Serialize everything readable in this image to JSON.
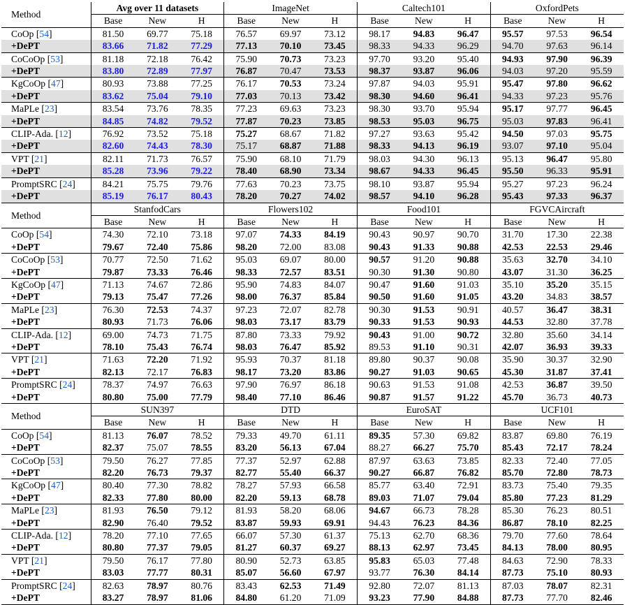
{
  "header_label": "Method",
  "col_labels": [
    "Base",
    "New",
    "H"
  ],
  "blocks": [
    {
      "datasets": [
        "Avg over 11 datasets",
        "ImageNet",
        "Caltech101",
        "OxfordPets"
      ],
      "first_bold": true,
      "shaded": true,
      "groups": [
        {
          "method": "CoOp",
          "cite": "54",
          "row1": [
            "81.50",
            "69.77",
            "75.18",
            "76.57",
            "69.97",
            "73.12",
            "98.17",
            "94.83",
            "96.47",
            "95.57",
            "97.53",
            "96.54"
          ],
          "row2": [
            "83.66",
            "71.82",
            "77.29",
            "77.13",
            "70.10",
            "73.45",
            "98.33",
            "94.33",
            "96.29",
            "94.70",
            "97.63",
            "96.14"
          ]
        },
        {
          "method": "CoCoOp",
          "cite": "53",
          "row1": [
            "81.18",
            "72.18",
            "76.42",
            "75.90",
            "70.73",
            "73.23",
            "97.70",
            "93.20",
            "95.40",
            "94.93",
            "97.90",
            "96.39"
          ],
          "row2": [
            "83.80",
            "72.89",
            "77.97",
            "76.87",
            "70.47",
            "73.53",
            "98.37",
            "93.87",
            "96.06",
            "94.03",
            "97.20",
            "95.59"
          ]
        },
        {
          "method": "KgCoOp",
          "cite": "47",
          "row1": [
            "80.93",
            "73.88",
            "77.25",
            "76.17",
            "70.53",
            "73.24",
            "97.87",
            "94.03",
            "95.91",
            "95.47",
            "97.80",
            "96.62"
          ],
          "row2": [
            "83.62",
            "75.04",
            "79.10",
            "77.03",
            "70.13",
            "73.42",
            "98.30",
            "94.60",
            "96.41",
            "94.33",
            "97.23",
            "95.76"
          ]
        },
        {
          "method": "MaPLe",
          "cite": "23",
          "row1": [
            "83.54",
            "73.76",
            "78.35",
            "77.23",
            "69.63",
            "73.23",
            "98.30",
            "93.70",
            "95.94",
            "95.17",
            "97.77",
            "96.45"
          ],
          "row2": [
            "84.85",
            "74.82",
            "79.52",
            "77.87",
            "70.23",
            "73.85",
            "98.53",
            "95.03",
            "96.75",
            "95.03",
            "97.83",
            "96.41"
          ]
        },
        {
          "method": "CLIP-Ada.",
          "cite": "12",
          "row1": [
            "76.92",
            "73.52",
            "75.18",
            "75.27",
            "68.67",
            "71.82",
            "97.27",
            "93.63",
            "95.42",
            "94.50",
            "97.03",
            "95.75"
          ],
          "row2": [
            "82.60",
            "74.43",
            "78.30",
            "75.17",
            "68.87",
            "71.88",
            "98.33",
            "94.13",
            "96.19",
            "93.07",
            "97.10",
            "95.04"
          ]
        },
        {
          "method": "VPT",
          "cite": "21",
          "row1": [
            "82.11",
            "71.73",
            "76.57",
            "75.90",
            "68.10",
            "71.79",
            "98.03",
            "94.30",
            "96.13",
            "95.13",
            "96.47",
            "95.80"
          ],
          "row2": [
            "85.28",
            "73.96",
            "79.22",
            "78.40",
            "68.90",
            "73.34",
            "98.67",
            "94.33",
            "96.45",
            "95.50",
            "96.33",
            "95.91"
          ]
        },
        {
          "method": "PromptSRC",
          "cite": "24",
          "row1": [
            "84.21",
            "75.75",
            "79.76",
            "77.63",
            "70.23",
            "73.75",
            "98.10",
            "93.87",
            "95.94",
            "95.27",
            "97.23",
            "96.24"
          ],
          "row2": [
            "85.19",
            "76.17",
            "80.43",
            "78.20",
            "70.27",
            "74.02",
            "98.57",
            "94.10",
            "96.28",
            "95.43",
            "97.33",
            "96.37"
          ]
        }
      ]
    },
    {
      "datasets": [
        "StanfodCars",
        "Flowers102",
        "Food101",
        "FGVCAircraft"
      ],
      "first_bold": false,
      "shaded": false,
      "groups": [
        {
          "method": "CoOp",
          "cite": "54",
          "row1": [
            "74.30",
            "72.10",
            "73.18",
            "97.07",
            "74.33",
            "84.19",
            "90.43",
            "90.97",
            "90.70",
            "31.70",
            "17.30",
            "22.38"
          ],
          "row2": [
            "79.67",
            "72.40",
            "75.86",
            "98.20",
            "72.00",
            "83.08",
            "90.43",
            "91.33",
            "90.88",
            "42.53",
            "22.53",
            "29.46"
          ]
        },
        {
          "method": "CoCoOp",
          "cite": "53",
          "row1": [
            "70.77",
            "72.50",
            "71.62",
            "95.03",
            "69.07",
            "80.00",
            "90.57",
            "91.20",
            "90.88",
            "35.63",
            "32.70",
            "34.10"
          ],
          "row2": [
            "79.87",
            "73.33",
            "76.46",
            "98.33",
            "72.57",
            "83.51",
            "90.30",
            "91.30",
            "90.80",
            "43.07",
            "31.30",
            "36.25"
          ]
        },
        {
          "method": "KgCoOp",
          "cite": "47",
          "row1": [
            "71.13",
            "74.67",
            "72.86",
            "95.90",
            "74.83",
            "84.07",
            "90.47",
            "91.60",
            "91.03",
            "35.10",
            "35.20",
            "35.15"
          ],
          "row2": [
            "79.13",
            "75.47",
            "77.26",
            "98.00",
            "76.37",
            "85.84",
            "90.50",
            "91.60",
            "91.05",
            "43.20",
            "34.83",
            "38.57"
          ]
        },
        {
          "method": "MaPLe",
          "cite": "23",
          "row1": [
            "76.30",
            "72.53",
            "74.37",
            "97.23",
            "72.07",
            "82.78",
            "90.30",
            "91.53",
            "90.91",
            "40.57",
            "36.47",
            "38.31"
          ],
          "row2": [
            "80.93",
            "71.73",
            "76.06",
            "98.03",
            "73.17",
            "83.79",
            "90.33",
            "91.53",
            "90.93",
            "44.53",
            "32.80",
            "37.78"
          ]
        },
        {
          "method": "CLIP-Ada.",
          "cite": "12",
          "row1": [
            "69.00",
            "74.73",
            "71.75",
            "87.80",
            "73.33",
            "79.92",
            "90.43",
            "91.00",
            "90.72",
            "32.80",
            "35.60",
            "34.14"
          ],
          "row2": [
            "78.10",
            "75.43",
            "76.74",
            "98.03",
            "76.47",
            "85.92",
            "89.53",
            "91.10",
            "90.31",
            "42.07",
            "36.93",
            "39.33"
          ]
        },
        {
          "method": "VPT",
          "cite": "21",
          "row1": [
            "71.63",
            "72.20",
            "71.92",
            "95.93",
            "70.37",
            "81.18",
            "89.80",
            "90.37",
            "90.08",
            "35.90",
            "30.37",
            "32.90"
          ],
          "row2": [
            "82.13",
            "72.17",
            "76.83",
            "98.17",
            "73.20",
            "83.86",
            "90.27",
            "91.03",
            "90.65",
            "45.30",
            "31.87",
            "37.41"
          ]
        },
        {
          "method": "PromptSRC",
          "cite": "24",
          "row1": [
            "78.37",
            "74.97",
            "76.63",
            "97.90",
            "76.97",
            "86.18",
            "90.63",
            "91.53",
            "91.08",
            "42.53",
            "36.87",
            "39.50"
          ],
          "row2": [
            "80.80",
            "75.00",
            "77.79",
            "98.40",
            "77.10",
            "86.46",
            "90.87",
            "91.57",
            "91.22",
            "45.70",
            "36.73",
            "40.73"
          ]
        }
      ]
    },
    {
      "datasets": [
        "SUN397",
        "DTD",
        "EuroSAT",
        "UCF101"
      ],
      "first_bold": false,
      "shaded": false,
      "groups": [
        {
          "method": "CoOp",
          "cite": "54",
          "row1": [
            "81.13",
            "76.07",
            "78.52",
            "79.33",
            "49.70",
            "61.11",
            "89.35",
            "57.30",
            "69.82",
            "83.87",
            "69.80",
            "76.19"
          ],
          "row2": [
            "82.37",
            "75.07",
            "78.55",
            "83.20",
            "56.13",
            "67.04",
            "88.27",
            "66.27",
            "75.70",
            "85.43",
            "72.17",
            "78.24"
          ]
        },
        {
          "method": "CoCoOp",
          "cite": "53",
          "row1": [
            "79.50",
            "76.27",
            "77.85",
            "77.37",
            "52.97",
            "62.88",
            "87.97",
            "63.63",
            "73.85",
            "82.33",
            "72.40",
            "77.05"
          ],
          "row2": [
            "82.20",
            "76.73",
            "79.37",
            "82.77",
            "55.40",
            "66.37",
            "90.27",
            "66.87",
            "76.82",
            "85.70",
            "72.80",
            "78.73"
          ]
        },
        {
          "method": "KgCoOp",
          "cite": "47",
          "row1": [
            "80.40",
            "77.30",
            "78.82",
            "78.27",
            "57.93",
            "66.58",
            "85.77",
            "63.40",
            "72.91",
            "83.73",
            "75.40",
            "79.35"
          ],
          "row2": [
            "82.33",
            "77.80",
            "80.00",
            "82.20",
            "59.13",
            "68.78",
            "89.03",
            "71.07",
            "79.04",
            "85.80",
            "77.23",
            "81.29"
          ]
        },
        {
          "method": "MaPLe",
          "cite": "23",
          "row1": [
            "81.93",
            "76.50",
            "79.12",
            "81.93",
            "58.20",
            "68.06",
            "94.67",
            "66.73",
            "78.28",
            "85.30",
            "76.23",
            "80.51"
          ],
          "row2": [
            "82.90",
            "76.40",
            "79.52",
            "83.87",
            "59.93",
            "69.91",
            "94.43",
            "76.23",
            "84.36",
            "86.87",
            "78.10",
            "82.25"
          ]
        },
        {
          "method": "CLIP-Ada.",
          "cite": "12",
          "row1": [
            "78.20",
            "77.10",
            "77.65",
            "66.07",
            "57.30",
            "61.37",
            "75.13",
            "62.70",
            "68.36",
            "79.70",
            "77.60",
            "78.64"
          ],
          "row2": [
            "80.80",
            "77.37",
            "79.05",
            "81.27",
            "60.37",
            "69.27",
            "88.13",
            "62.97",
            "73.45",
            "84.13",
            "78.00",
            "80.95"
          ]
        },
        {
          "method": "VPT",
          "cite": "21",
          "row1": [
            "79.50",
            "76.17",
            "77.80",
            "80.90",
            "52.73",
            "63.85",
            "95.83",
            "65.03",
            "77.48",
            "84.63",
            "72.90",
            "78.33"
          ],
          "row2": [
            "83.03",
            "77.77",
            "80.31",
            "85.07",
            "56.60",
            "67.97",
            "93.77",
            "76.30",
            "84.14",
            "87.73",
            "75.10",
            "80.93"
          ]
        },
        {
          "method": "PromptSRC",
          "cite": "24",
          "row1": [
            "82.63",
            "78.97",
            "80.76",
            "83.43",
            "62.53",
            "71.49",
            "92.80",
            "72.07",
            "81.13",
            "87.03",
            "78.07",
            "82.31"
          ],
          "row2": [
            "83.27",
            "78.97",
            "81.06",
            "84.80",
            "61.20",
            "71.09",
            "93.23",
            "77.90",
            "84.88",
            "87.73",
            "77.70",
            "82.46"
          ]
        }
      ]
    }
  ],
  "bold": [
    [
      [
        [],
        [
          0,
          1,
          2,
          3,
          4,
          5,
          6,
          7,
          8,
          9,
          10,
          11
        ]
      ],
      [
        [],
        [
          0,
          1,
          2,
          3,
          5,
          6,
          7,
          8,
          9,
          10,
          11
        ]
      ]
    ],
    [],
    []
  ],
  "dept_label": "+DePT"
}
